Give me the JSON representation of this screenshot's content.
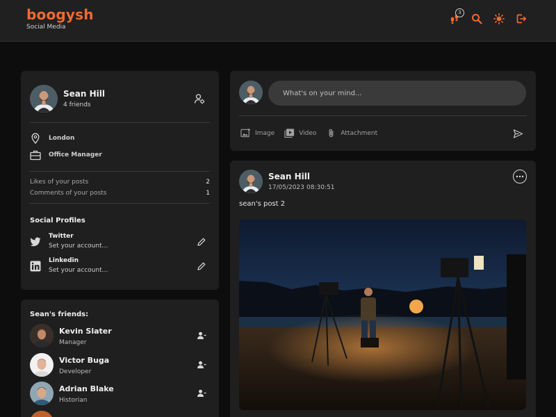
{
  "brand": {
    "name": "boogysh",
    "subtitle": "Social Media"
  },
  "header": {
    "icons": [
      "footprints-icon",
      "search-icon",
      "sun-icon",
      "logout-icon"
    ],
    "notification_count": "3"
  },
  "profile": {
    "name": "Sean Hill",
    "friends_count": "4 friends",
    "location": "London",
    "occupation": "Office Manager",
    "stats": [
      {
        "label": "Likes of your posts",
        "value": "2"
      },
      {
        "label": "Comments of your posts",
        "value": "1"
      }
    ],
    "social_title": "Social Profiles",
    "socials": [
      {
        "name": "Twitter",
        "sub": "Set your account..."
      },
      {
        "name": "Linkedin",
        "sub": "Set your account..."
      }
    ]
  },
  "friends": {
    "title": "Sean's friends:",
    "items": [
      {
        "name": "Kevin Slater",
        "role": "Manager"
      },
      {
        "name": "Victor Buga",
        "role": "Developer"
      },
      {
        "name": "Adrian Blake",
        "role": "Historian"
      }
    ]
  },
  "composer": {
    "placeholder": "What's on your mind...",
    "actions": {
      "image": "Image",
      "video": "Video",
      "attachment": "Attachment"
    }
  },
  "post": {
    "author": "Sean Hill",
    "date": "17/05/2023",
    "time": "08:30:51",
    "text": "sean's post 2"
  },
  "colors": {
    "accent": "#f26a2e",
    "card": "#1f1f1f",
    "background": "#0d0d0d"
  }
}
